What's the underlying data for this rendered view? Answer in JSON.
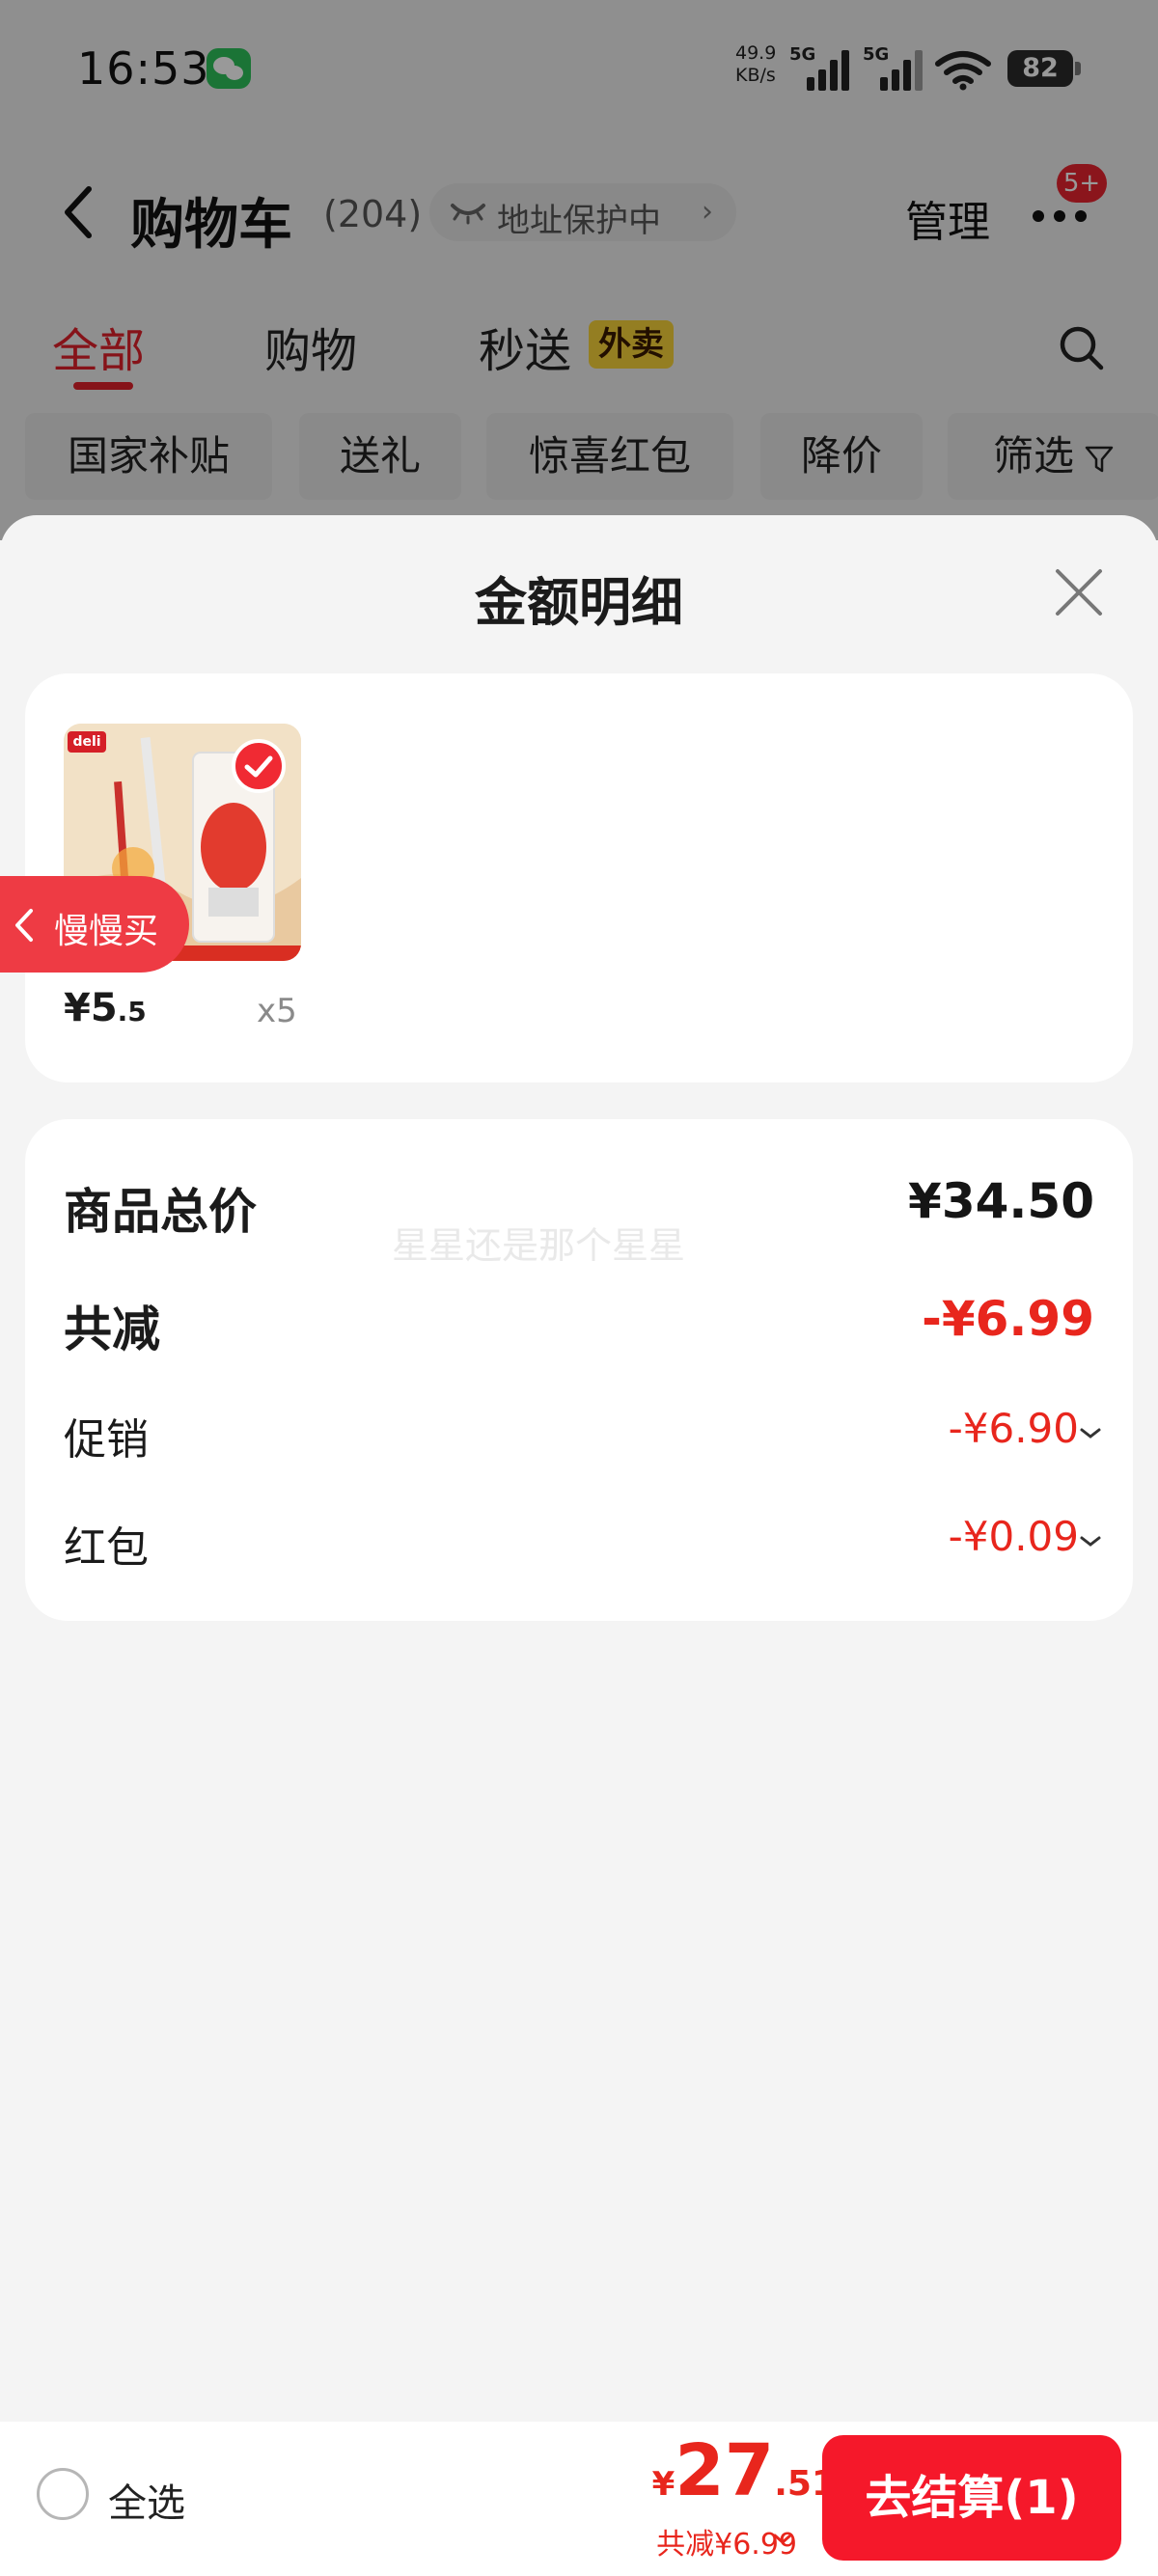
{
  "status_bar": {
    "time": "16:53",
    "net_speed_value": "49.9",
    "net_speed_unit": "KB/s",
    "sim1_label": "5G",
    "sim2_label": "5G",
    "battery": "82"
  },
  "header": {
    "title": "购物车",
    "count": "(204)",
    "address_protect": "地址保护中",
    "manage": "管理",
    "more_badge": "5+"
  },
  "tabs": {
    "all": "全部",
    "shopping": "购物",
    "express": "秒送",
    "takeout_badge": "外卖"
  },
  "chips": [
    "国家补贴",
    "送礼",
    "惊喜红包",
    "降价",
    "筛选"
  ],
  "sheet": {
    "title": "金额明细",
    "item": {
      "brand_logo": "deli",
      "price_int": "¥5",
      "price_dec": ".5",
      "qty": "x5"
    },
    "slow_buy": "慢慢买",
    "watermark": "星星还是那个星星",
    "summary": {
      "total_label": "商品总价",
      "total_value": "¥34.50",
      "reduce_label": "共减",
      "reduce_value": "-¥6.99",
      "promo_label": "促销",
      "promo_value": "-¥6.90",
      "redpacket_label": "红包",
      "redpacket_value": "-¥0.09"
    }
  },
  "bottom": {
    "select_all": "全选",
    "currency": "¥",
    "price_int": "27",
    "price_dec": ".51",
    "saved": "共减¥6.99",
    "checkout": "去结算(1)"
  },
  "colors": {
    "accent": "#e8261d",
    "checkout_bg": "#f5182a",
    "takeout_badge": "#f7d33a"
  }
}
